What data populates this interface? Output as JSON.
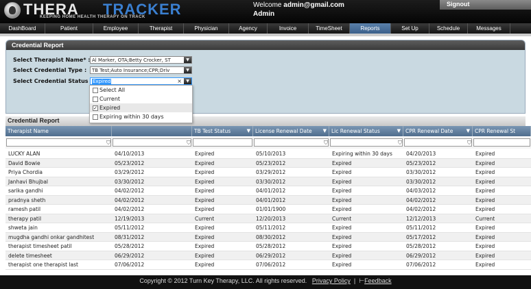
{
  "header": {
    "logo_part1": "THERA",
    "logo_part2": "TRACKER",
    "tagline": "KEEPING HOME HEALTH THERAPY ON TRACK",
    "welcome_prefix": "Welcome",
    "user_email": "admin@gmail.com",
    "role": "Admin",
    "signout_label": "Signout"
  },
  "nav": {
    "items": [
      {
        "label": "DashBoard"
      },
      {
        "label": "Patient"
      },
      {
        "label": "Employee"
      },
      {
        "label": "Therapist"
      },
      {
        "label": "Physician"
      },
      {
        "label": "Agency"
      },
      {
        "label": "Invoice"
      },
      {
        "label": "TimeSheet"
      },
      {
        "label": "Reports"
      },
      {
        "label": "Set Up"
      },
      {
        "label": "Schedule"
      },
      {
        "label": "Messages"
      }
    ],
    "active": "Reports"
  },
  "filters": {
    "panel_title": "Credential Report",
    "therapist_label": "Select Therapist Name* :",
    "therapist_value": "Al Marker, OTA;Betty Crocker, ST",
    "type_label": "Select Credential Type :",
    "type_value": "TB Test;Auto Insurance;CPR;Driv",
    "status_label": "Select Credential Status :",
    "status_value": "Expired",
    "status_options": [
      {
        "label": "Select All",
        "checked": false
      },
      {
        "label": "Current",
        "checked": false
      },
      {
        "label": "Expired",
        "checked": true
      },
      {
        "label": "Expiring within 30 days",
        "checked": false
      }
    ]
  },
  "grid": {
    "title": "Credential Report",
    "columns": [
      "Therapist Name",
      "",
      "TB Test Status",
      "License Renewal Date",
      "Lic Renewal Status",
      "CPR Renewal Date",
      "CPR Renewal St"
    ],
    "rows": [
      [
        "LUCKY ALAN",
        "04/10/2013",
        "Expired",
        "05/10/2013",
        "Expiring within 30 days",
        "04/20/2013",
        "Expired"
      ],
      [
        "David Bowie",
        "05/23/2012",
        "Expired",
        "05/23/2012",
        "Expired",
        "05/23/2012",
        "Expired"
      ],
      [
        "Priya Chordia",
        "03/29/2012",
        "Expired",
        "03/29/2012",
        "Expired",
        "03/30/2012",
        "Expired"
      ],
      [
        "Janhavi Bhujbal",
        "03/30/2012",
        "Expired",
        "03/30/2012",
        "Expired",
        "03/30/2012",
        "Expired"
      ],
      [
        "sarika gandhi",
        "04/02/2012",
        "Expired",
        "04/01/2012",
        "Expired",
        "04/03/2012",
        "Expired"
      ],
      [
        "pradnya sheth",
        "04/02/2012",
        "Expired",
        "04/01/2012",
        "Expired",
        "04/02/2012",
        "Expired"
      ],
      [
        "ramesh patil",
        "04/02/2012",
        "Expired",
        "01/01/1900",
        "Expired",
        "04/02/2012",
        "Expired"
      ],
      [
        "therapy patil",
        "12/19/2013",
        "Current",
        "12/20/2013",
        "Current",
        "12/12/2013",
        "Current"
      ],
      [
        "shweta jain",
        "05/11/2012",
        "Expired",
        "05/11/2012",
        "Expired",
        "05/11/2012",
        "Expired"
      ],
      [
        "mugdha gandhi onkar gandhitest",
        "08/31/2012",
        "Expired",
        "08/30/2012",
        "Expired",
        "05/17/2012",
        "Expired"
      ],
      [
        "therapist timesheet patil",
        "05/28/2012",
        "Expired",
        "05/28/2012",
        "Expired",
        "05/28/2012",
        "Expired"
      ],
      [
        "delete timesheet",
        "06/29/2012",
        "Expired",
        "06/29/2012",
        "Expired",
        "06/29/2012",
        "Expired"
      ],
      [
        "therapist one therapist last",
        "07/06/2012",
        "Expired",
        "07/06/2012",
        "Expired",
        "07/06/2012",
        "Expired"
      ]
    ]
  },
  "footer": {
    "copyright": "Copyright © 2012 Turn Key Therapy, LLC. All rights reserved.",
    "privacy_label": "Privacy Policy",
    "separator": "|",
    "feedback_label": "Feedback"
  }
}
